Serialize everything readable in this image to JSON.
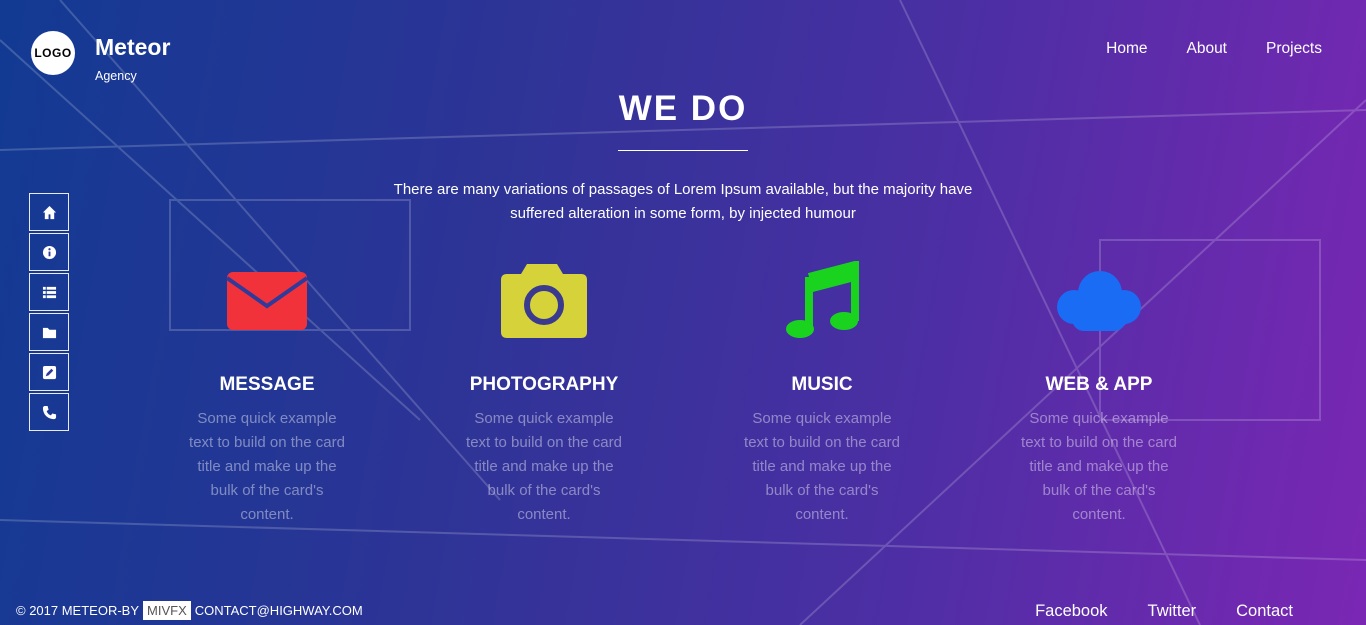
{
  "brand": {
    "logo": "LOGO",
    "name": "Meteor",
    "subtitle": "Agency"
  },
  "nav": [
    "Home",
    "About",
    "Projects"
  ],
  "sidebar": [
    "home-icon",
    "info-icon",
    "list-icon",
    "folder-icon",
    "edit-icon",
    "phone-icon"
  ],
  "section": {
    "title": "WE DO",
    "intro": "There are many variations of passages of Lorem Ipsum available, but the majority have suffered alteration in some form, by injected humour"
  },
  "cards": [
    {
      "title": "MESSAGE",
      "text": "Some quick example text to build on the card title and make up the bulk of the card's content.",
      "icon": "envelope-icon",
      "color": "#f2323a"
    },
    {
      "title": "PHOTOGRAPHY",
      "text": "Some quick example text to build on the card title and make up the bulk of the card's content.",
      "icon": "camera-icon",
      "color": "#d6d33a"
    },
    {
      "title": "MUSIC",
      "text": "Some quick example text to build on the card title and make up the bulk of the card's content.",
      "icon": "music-icon",
      "color": "#19d31e"
    },
    {
      "title": "WEB & APP",
      "text": "Some quick example text to build on the card title and make up the bulk of the card's content.",
      "icon": "cloud-icon",
      "color": "#1a6cf5"
    }
  ],
  "footer": {
    "copyright": "© 2017 METEOR-BY",
    "badge": "MIVFX",
    "contact": "CONTACT@HIGHWAY.COM",
    "links": [
      "Facebook",
      "Twitter",
      "Contact"
    ]
  }
}
